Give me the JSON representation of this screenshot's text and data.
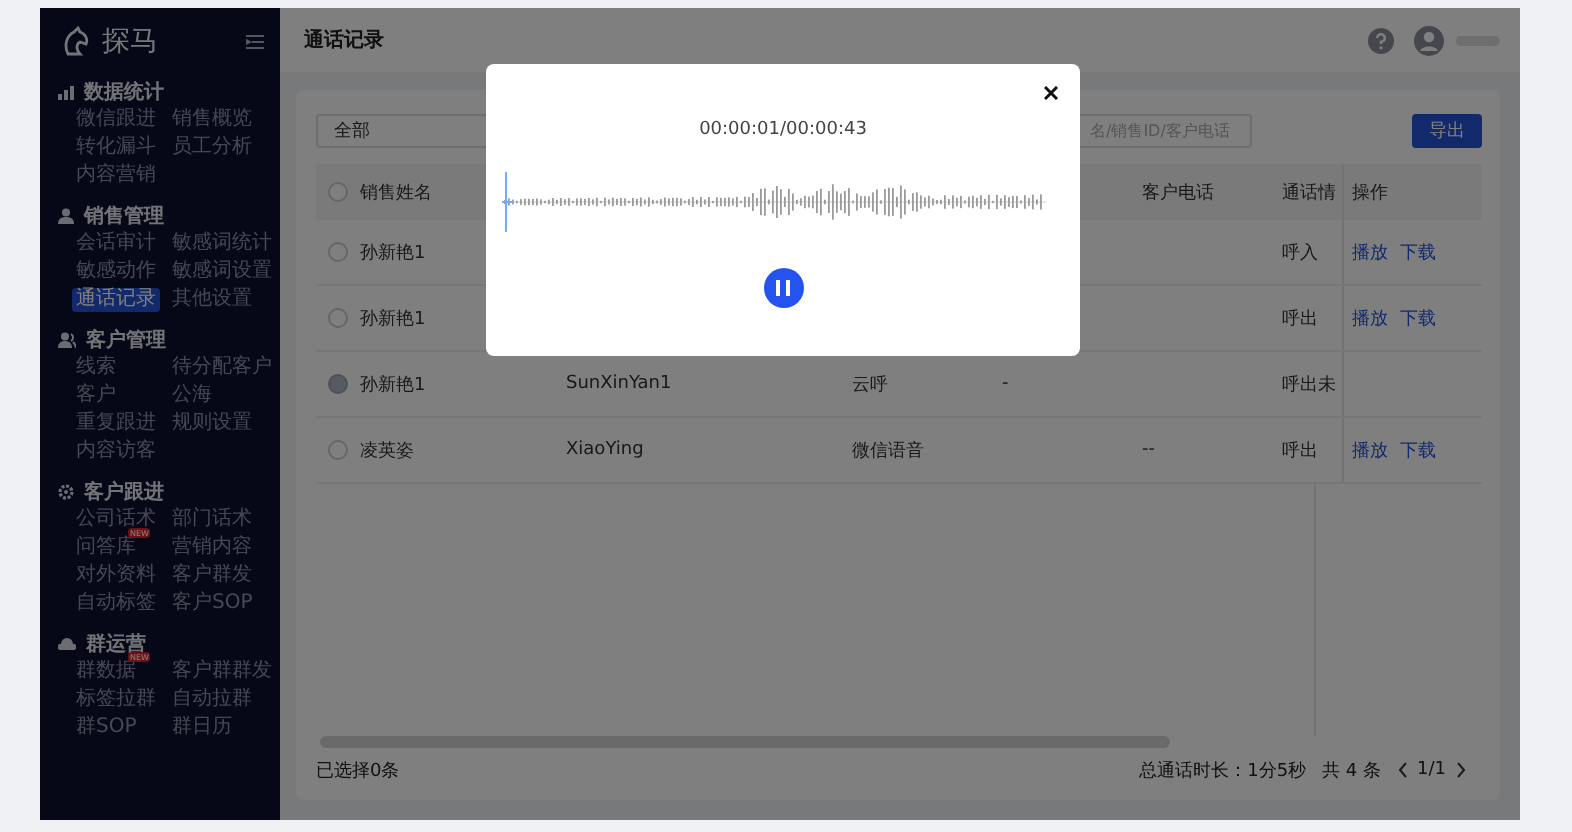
{
  "sidebar": {
    "logo": "探马",
    "sections": [
      {
        "title": "数据统计",
        "items": [
          {
            "label": "微信跟进",
            "selected": false
          },
          {
            "label": "销售概览",
            "selected": false
          },
          {
            "label": "转化漏斗",
            "selected": false
          },
          {
            "label": "员工分析",
            "selected": false
          },
          {
            "label": "内容营销",
            "selected": false
          }
        ]
      },
      {
        "title": "销售管理",
        "items": [
          {
            "label": "会话审计",
            "selected": false
          },
          {
            "label": "敏感词统计",
            "selected": false
          },
          {
            "label": "敏感动作",
            "selected": false
          },
          {
            "label": "敏感词设置",
            "selected": false
          },
          {
            "label": "通话记录",
            "selected": true
          },
          {
            "label": "其他设置",
            "selected": false
          }
        ]
      },
      {
        "title": "客户管理",
        "items": [
          {
            "label": "线索",
            "selected": false
          },
          {
            "label": "待分配客户",
            "selected": false
          },
          {
            "label": "客户",
            "selected": false
          },
          {
            "label": "公海",
            "selected": false
          },
          {
            "label": "重复跟进",
            "selected": false
          },
          {
            "label": "规则设置",
            "selected": false
          },
          {
            "label": "内容访客",
            "selected": false
          }
        ]
      },
      {
        "title": "客户跟进",
        "items": [
          {
            "label": "公司话术",
            "selected": false
          },
          {
            "label": "部门话术",
            "selected": false
          },
          {
            "label": "问答库",
            "selected": false,
            "badge": "NEW"
          },
          {
            "label": "营销内容",
            "selected": false
          },
          {
            "label": "对外资料",
            "selected": false
          },
          {
            "label": "客户群发",
            "selected": false
          },
          {
            "label": "自动标签",
            "selected": false
          },
          {
            "label": "客户SOP",
            "selected": false
          }
        ]
      },
      {
        "title": "群运营",
        "items": [
          {
            "label": "群数据",
            "selected": false,
            "badge": "NEW"
          },
          {
            "label": "客户群群发",
            "selected": false
          },
          {
            "label": "标签拉群",
            "selected": false
          },
          {
            "label": "自动拉群",
            "selected": false
          },
          {
            "label": "群SOP",
            "selected": false
          },
          {
            "label": "群日历",
            "selected": false
          }
        ]
      }
    ]
  },
  "header": {
    "title": "通话记录"
  },
  "toolbar": {
    "filter": "全部",
    "search_placeholder": "名/销售ID/客户电话",
    "export_button": "导出"
  },
  "table": {
    "all_checked": false,
    "columns": [
      {
        "label": "销售姓名"
      },
      {},
      {},
      {},
      {
        "label": "客户电话"
      },
      {
        "label": "通话情"
      },
      {
        "label": "操作"
      }
    ],
    "rows": [
      {
        "disabled": false,
        "cells": [
          "孙新艳1",
          null,
          null,
          null,
          null,
          "呼入"
        ],
        "actions": [
          "播放",
          "下载"
        ]
      },
      {
        "disabled": false,
        "cells": [
          "孙新艳1",
          null,
          null,
          null,
          null,
          "呼出"
        ],
        "actions": [
          "播放",
          "下载"
        ]
      },
      {
        "disabled": true,
        "cells": [
          "孙新艳1",
          "SunXinYan1",
          "云呼",
          "-",
          null,
          "呼出未"
        ]
      },
      {
        "disabled": false,
        "cells": [
          "凌英姿",
          "XiaoYing",
          "微信语音",
          null,
          "--",
          "呼出"
        ],
        "actions": [
          "播放",
          "下载"
        ]
      }
    ]
  },
  "footer": {
    "selected": "已选择0条",
    "total_duration": "总通话时长：1分5秒",
    "total_count": "共 4 条",
    "page": "1/1"
  },
  "player": {
    "time": "00:00:01/00:00:43",
    "playing": true
  }
}
